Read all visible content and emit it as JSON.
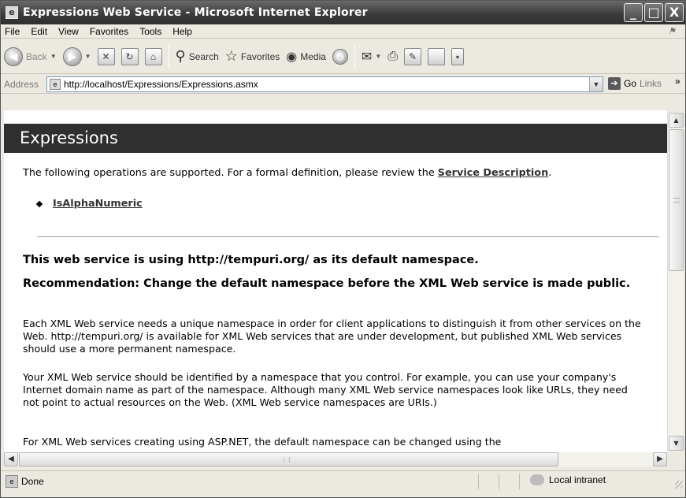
{
  "window": {
    "title": "Expressions Web Service - Microsoft Internet Explorer",
    "minimize": "_",
    "maximize": "□",
    "close": "X"
  },
  "menu": [
    "File",
    "Edit",
    "View",
    "Favorites",
    "Tools",
    "Help"
  ],
  "toolbar": {
    "back": "Back",
    "search": "Search",
    "favorites": "Favorites",
    "media": "Media"
  },
  "address": {
    "label": "Address",
    "url": "http://localhost/Expressions/Expressions.asmx",
    "go": "Go",
    "links": "Links"
  },
  "page": {
    "banner": "Expressions",
    "intro_prefix": "The following operations are supported. For a formal definition, please review the ",
    "service_description": "Service Description",
    "intro_suffix": ".",
    "operations": [
      "IsAlphaNumeric"
    ],
    "namespace_heading": "This web service is using http://tempuri.org/ as its default namespace.",
    "recommendation_heading": "Recommendation: Change the default namespace before the XML Web service is made public.",
    "paragraph1": "Each XML Web service needs a unique namespace in order for client applications to distinguish it from other services on the Web. http://tempuri.org/ is available for XML Web services that are under development, but published XML Web services should use a more permanent namespace.",
    "paragraph2": "Your XML Web service should be identified by a namespace that you control. For example, you can use your company's Internet domain name as part of the namespace. Although many XML Web service namespaces look like URLs, they need not point to actual resources on the Web. (XML Web service namespaces are URIs.)",
    "paragraph3": "For XML Web services creating using ASP.NET, the default namespace can be changed using the"
  },
  "status": {
    "text": "Done",
    "zone": "Local intranet"
  }
}
